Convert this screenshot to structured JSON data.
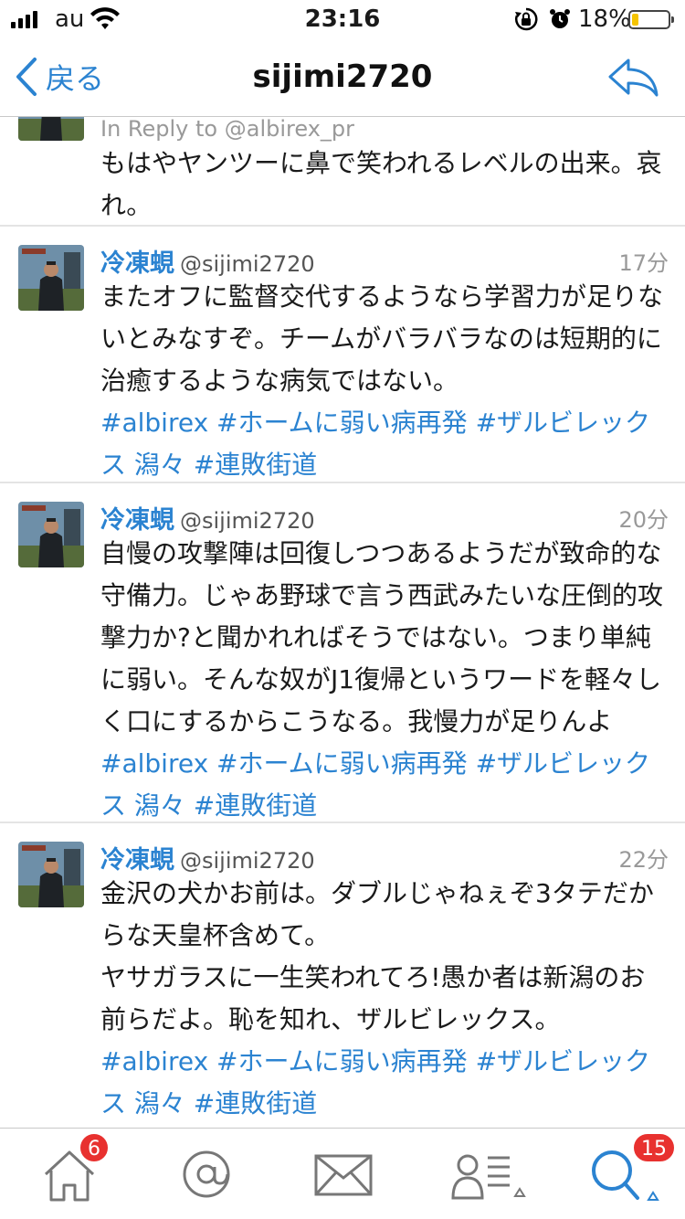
{
  "status_bar": {
    "carrier": "au",
    "time": "23:16",
    "battery_percent": "18%",
    "battery_level": 0.18,
    "icons": [
      "signal-icon",
      "wifi-icon",
      "rotation-lock-icon",
      "alarm-icon",
      "battery-icon"
    ]
  },
  "nav": {
    "back_label": "戻る",
    "title": "sijimi2720",
    "reply_icon": "reply-icon",
    "accent_color": "#2b83d1"
  },
  "tweets": [
    {
      "reply_to": "In Reply to @albirex_pr",
      "text": "もはやヤンツーに鼻で笑われるレベルの出来。哀\nれ。"
    },
    {
      "name": "冷凍蜆",
      "handle": "@sijimi2720",
      "time": "17分",
      "text": "またオフに監督交代するようなら学習力が足りな\nいとみなすぞ。チームがバラバラなのは短期的に\n治癒するような病気ではない。",
      "hashtags": "#albirex #ホームに弱い病再発 #ザルビレックス\n潟々 #連敗街道"
    },
    {
      "name": "冷凍蜆",
      "handle": "@sijimi2720",
      "time": "20分",
      "text": "自慢の攻撃陣は回復しつつあるようだが致命的な\n守備力。じゃあ野球で言う西武みたいな圧倒的攻\n撃力か?と聞かれればそうではない。つまり単純\nに弱い。そんな奴がJ1復帰というワードを軽々し\nく口にするからこうなる。我慢力が足りんよ",
      "hashtags": "#albirex #ホームに弱い病再発 #ザルビレックス\n潟々 #連敗街道"
    },
    {
      "name": "冷凍蜆",
      "handle": "@sijimi2720",
      "time": "22分",
      "text": "金沢の犬かお前は。ダブルじゃねぇぞ3タテだか\nらな天皇杯含めて。\nヤサガラスに一生笑われてろ!愚か者は新潟のお\n前らだよ。恥を知れ、ザルビレックス。",
      "hashtags": "#albirex #ホームに弱い病再発 #ザルビレックス\n潟々 #連敗街道"
    }
  ],
  "tab_bar": {
    "home_badge": "6",
    "search_badge": "15",
    "tabs": [
      "home-icon",
      "mentions-icon",
      "messages-icon",
      "profile-icon",
      "search-icon"
    ],
    "badge_color": "#e8312f"
  }
}
